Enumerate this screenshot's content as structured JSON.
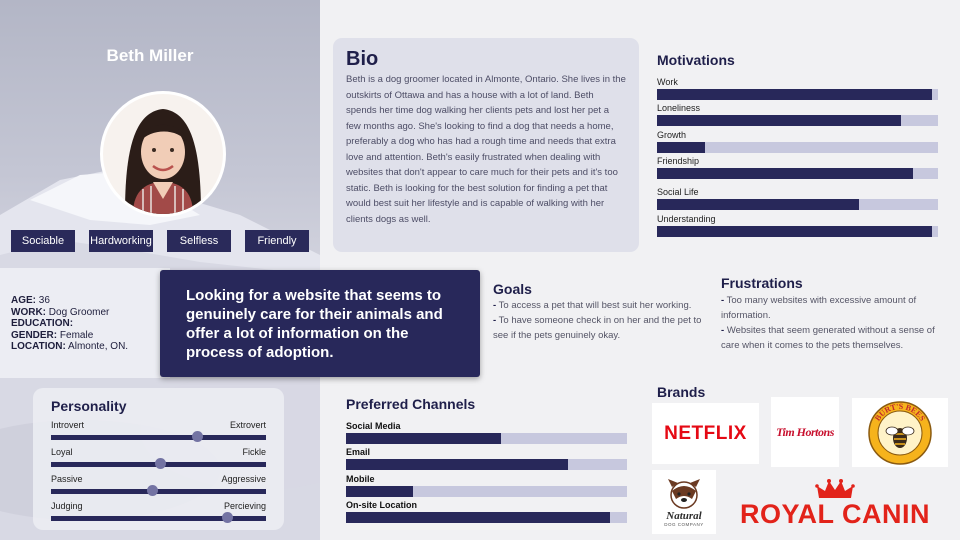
{
  "persona": {
    "name": "Beth Miller",
    "traits": [
      "Sociable",
      "Hardworking",
      "Selfless",
      "Friendly"
    ],
    "info": {
      "age_label": "AGE:",
      "age": "36",
      "work_label": "WORK:",
      "work": "Dog Groomer",
      "education_label": "EDUCATION:",
      "education": "",
      "gender_label": "GENDER:",
      "gender": "Female",
      "location_label": "LOCATION:",
      "location": "Almonte, ON."
    },
    "quote": "Looking for a website that seems to genuinely care for their animals and offer a lot of information on the process of adoption."
  },
  "personality": {
    "title": "Personality",
    "sliders": [
      {
        "left": "Introvert",
        "right": "Extrovert",
        "value": 0.68
      },
      {
        "left": "Loyal",
        "right": "Fickle",
        "value": 0.51
      },
      {
        "left": "Passive",
        "right": "Aggressive",
        "value": 0.47
      },
      {
        "left": "Judging",
        "right": "Percieving",
        "value": 0.82
      }
    ]
  },
  "bio": {
    "title": "Bio",
    "text": "Beth is a dog groomer located in Almonte, Ontario. She lives in the outskirts of Ottawa and has a house with a lot of land. Beth spends her time dog walking her clients pets and lost her pet a few months ago. She's looking to find a dog that needs a home, preferably a dog who has had a rough time and needs that extra love and attention. Beth's easily frustrated when dealing with websites that don't appear to care much for their pets and it's too static. Beth is looking for the best solution for finding a pet that would best suit her lifestyle and is capable of walking with her clients dogs as well."
  },
  "motivations": {
    "title": "Motivations",
    "items": [
      {
        "label": "Work",
        "value": 0.98
      },
      {
        "label": "Loneliness",
        "value": 0.87
      },
      {
        "label": "Growth",
        "value": 0.17
      },
      {
        "label": "Friendship",
        "value": 0.91
      },
      {
        "label": "Social Life",
        "value": 0.72
      },
      {
        "label": "Understanding",
        "value": 0.98
      }
    ]
  },
  "goals": {
    "title": "Goals",
    "items": [
      "To access a pet that will best suit her working.",
      "To have someone check in on her and the pet to see if the pets genuinely okay."
    ]
  },
  "frustrations": {
    "title": "Frustrations",
    "items": [
      "Too many websites with excessive amount of information.",
      "Websites that seem generated without a sense of care when it comes to the pets themselves."
    ]
  },
  "channels": {
    "title": "Preferred Channels",
    "items": [
      {
        "label": "Social Media",
        "value": 0.55
      },
      {
        "label": "Email",
        "value": 0.79
      },
      {
        "label": "Mobile",
        "value": 0.24
      },
      {
        "label": "On-site Location",
        "value": 0.94
      }
    ]
  },
  "brands": {
    "title": "Brands",
    "logos": {
      "netflix": "NETFLIX",
      "timhortons": "Tim Hortons",
      "burtsbees": "BURT'S BEES",
      "natural": "Natural",
      "natural_sub": "DOG COMPANY",
      "royalcanin": "ROYAL CANIN"
    },
    "colors": {
      "netflix": "#e50914",
      "timhortons": "#c8102e",
      "royalcanin": "#e2231a",
      "burtsbees": "#f6b31c"
    }
  },
  "colors": {
    "navy": "#28285a",
    "bar_bg": "#c7c8de"
  }
}
